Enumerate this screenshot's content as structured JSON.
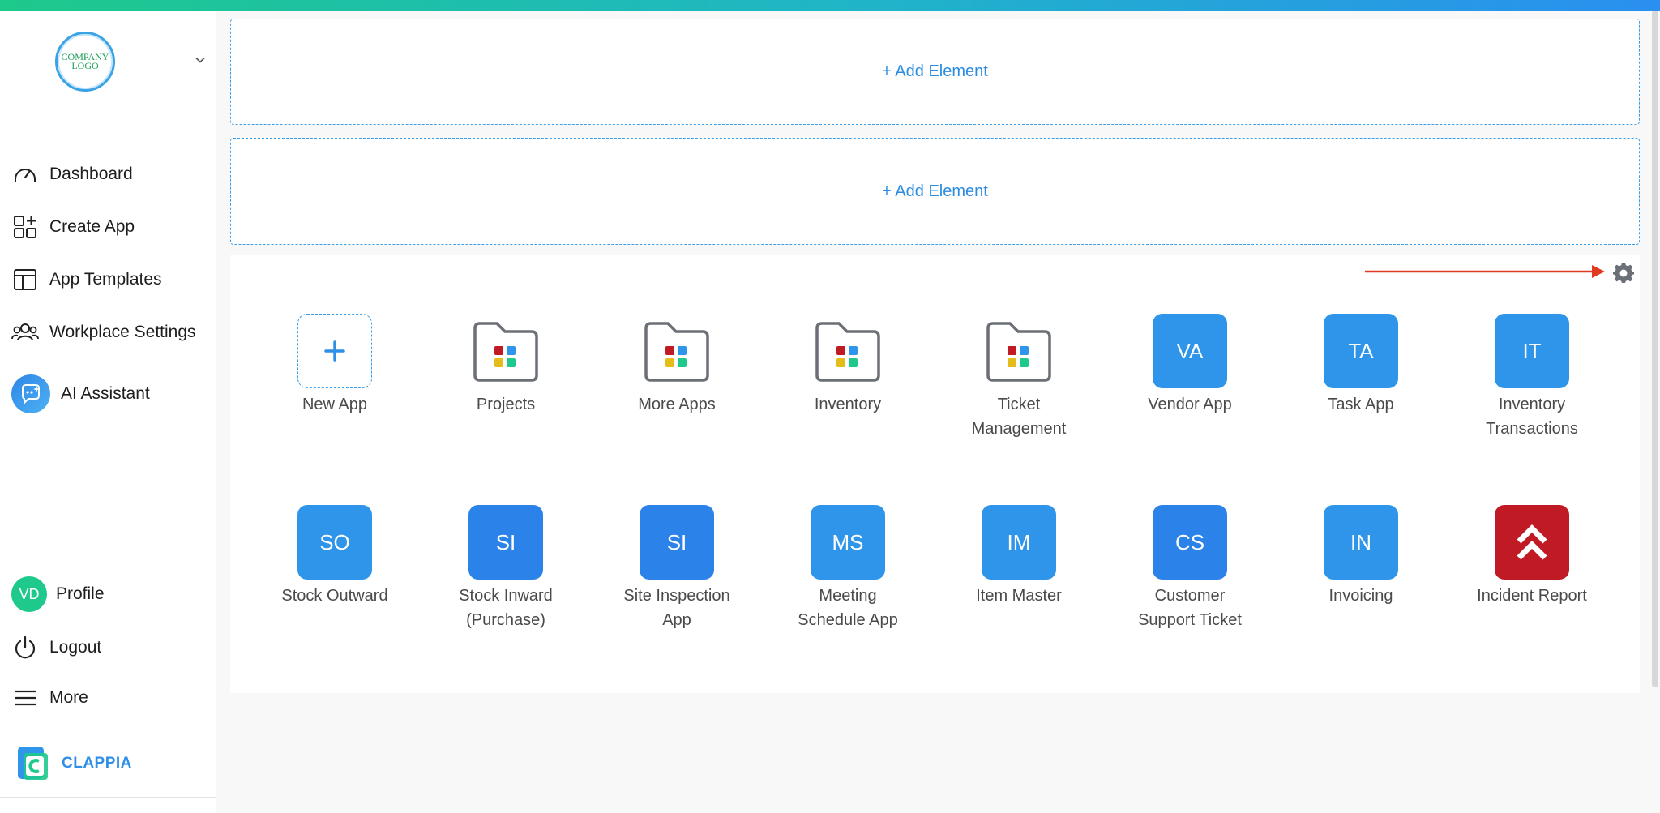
{
  "workspace": {
    "logo_text_1": "COMPANY",
    "logo_text_2": "LOGO"
  },
  "sidebar": {
    "nav": [
      {
        "label": "Dashboard"
      },
      {
        "label": "Create App"
      },
      {
        "label": "App Templates"
      },
      {
        "label": "Workplace Settings"
      },
      {
        "label": "AI Assistant"
      }
    ],
    "profile": {
      "initials": "VD",
      "label": "Profile"
    },
    "logout_label": "Logout",
    "more_label": "More",
    "brand": "CLAPPIA"
  },
  "main": {
    "add_element_1": "+ Add Element",
    "add_element_2": "+ Add Element",
    "apps_row1": [
      {
        "name": "New App",
        "kind": "new"
      },
      {
        "name": "Projects",
        "kind": "folder"
      },
      {
        "name": "More Apps",
        "kind": "folder"
      },
      {
        "name": "Inventory",
        "kind": "folder"
      },
      {
        "name_line1": "Ticket",
        "name_line2": "Management",
        "kind": "folder"
      },
      {
        "initials": "VA",
        "name": "Vendor App",
        "kind": "tile"
      },
      {
        "initials": "TA",
        "name": "Task App",
        "kind": "tile"
      },
      {
        "initials": "IT",
        "name_line1": "Inventory",
        "name_line2": "Transactions",
        "kind": "tile"
      }
    ],
    "apps_row2": [
      {
        "initials": "SO",
        "name": "Stock Outward"
      },
      {
        "initials": "SI",
        "name_line1": "Stock Inward",
        "name_line2": "(Purchase)"
      },
      {
        "initials": "SI",
        "name_line1": "Site Inspection",
        "name_line2": "App"
      },
      {
        "initials": "MS",
        "name_line1": "Meeting",
        "name_line2": "Schedule App"
      },
      {
        "initials": "IM",
        "name": "Item Master"
      },
      {
        "initials": "CS",
        "name_line1": "Customer",
        "name_line2": "Support Ticket"
      },
      {
        "initials": "IN",
        "name": "Invoicing"
      },
      {
        "name": "Incident Report",
        "kind": "red-icon"
      }
    ]
  },
  "colors": {
    "accent": "#2f95ea",
    "red": "#c01a24",
    "arrow": "#e23a22",
    "profile_green": "#1ec98b"
  }
}
